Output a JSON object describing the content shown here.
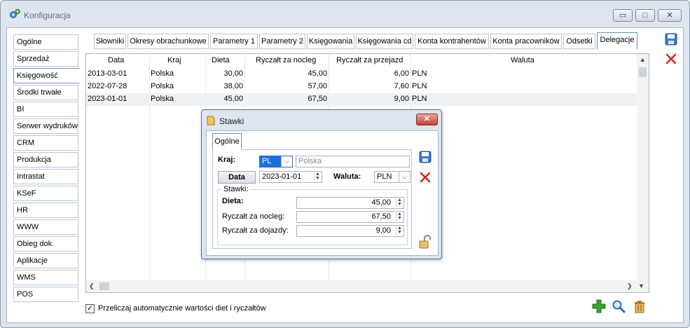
{
  "window": {
    "title": "Konfiguracja",
    "controls": {
      "minimize": "▭",
      "maximize": "□",
      "close": "✕"
    }
  },
  "sidebar": {
    "items": [
      {
        "label": "Ogólne"
      },
      {
        "label": "Sprzedaż"
      },
      {
        "label": "Księgowość"
      },
      {
        "label": "Środki trwałe"
      },
      {
        "label": "BI"
      },
      {
        "label": "Serwer wydruków"
      },
      {
        "label": "CRM"
      },
      {
        "label": "Produkcja"
      },
      {
        "label": "Intrastat"
      },
      {
        "label": "KSeF"
      },
      {
        "label": "HR"
      },
      {
        "label": "WWW"
      },
      {
        "label": "Obieg dok."
      },
      {
        "label": "Aplikacje"
      },
      {
        "label": "WMS"
      },
      {
        "label": "POS"
      }
    ],
    "active_index": 2
  },
  "tabs": [
    {
      "label": "Słowniki"
    },
    {
      "label": "Okresy obrachunkowe"
    },
    {
      "label": "Parametry 1"
    },
    {
      "label": "Parametry 2"
    },
    {
      "label": "Księgowania"
    },
    {
      "label": "Księgowania cd"
    },
    {
      "label": "Konta kontrahentów"
    },
    {
      "label": "Konta pracowników"
    },
    {
      "label": "Odsetki"
    },
    {
      "label": "Delegacje"
    }
  ],
  "grid": {
    "columns": [
      "Data",
      "Kraj",
      "Dieta",
      "Ryczałt za nocleg",
      "Ryczałt za przejazd",
      "Waluta"
    ],
    "rows": [
      [
        "2013-03-01",
        "Polska",
        "30,00",
        "45,00",
        "6,00",
        "PLN"
      ],
      [
        "2022-07-28",
        "Polska",
        "38,00",
        "57,00",
        "7,60",
        "PLN"
      ],
      [
        "2023-01-01",
        "Polska",
        "45,00",
        "67,50",
        "9,00",
        "PLN"
      ]
    ]
  },
  "checkbox": {
    "label": "Przeliczaj automatycznie wartości diet i ryczałtów",
    "checked": true
  },
  "dialog": {
    "title": "Stawki",
    "tab": "Ogólne",
    "kraj_label": "Kraj:",
    "kraj_code": "PL",
    "kraj_name_placeholder": "Polska",
    "data_button": "Data",
    "data_value": "2023-01-01",
    "waluta_label": "Waluta:",
    "waluta_value": "PLN",
    "group_title": "Stawki:",
    "dieta_label": "Dieta:",
    "dieta_value": "45,00",
    "nocleg_label": "Ryczałt za nocleg:",
    "nocleg_value": "67,50",
    "dojazdy_label": "Ryczałt za dojazdy:",
    "dojazdy_value": "9,00"
  },
  "colors": {
    "accent_blue": "#1e6fd9",
    "delete_red": "#d42a1f",
    "add_green": "#3aa335"
  }
}
